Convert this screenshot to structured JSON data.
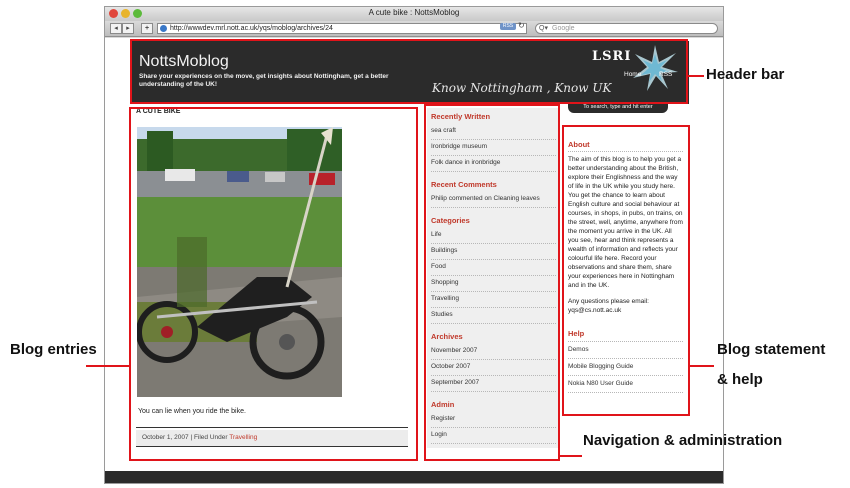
{
  "window": {
    "title": "A cute bike : NottsMoblog",
    "back_label": "◂",
    "forward_label": "▸",
    "add_label": "+",
    "url": "http://wwwdev.mrl.nott.ac.uk/yqs/moblog/archives/24",
    "rss_badge": "RSS",
    "reload_glyph": "↻",
    "search_placeholder": "Google"
  },
  "header": {
    "blog_title": "NottsMoblog",
    "tagline": "Share your experiences on the move, get insights about Nottingham, get a better understanding of the UK!",
    "slogan": "Know Nottingham , Know UK",
    "logo_text": "LSRI",
    "home_link": "Home",
    "rss_link": "RSS",
    "search_hint": "To search, type and hit enter"
  },
  "post": {
    "title": "A CUTE BIKE",
    "caption": "You can lie when you ride the bike.",
    "date": "October 1, 2007",
    "separator": "|",
    "filed_prefix": "Filed Under",
    "category": "Travelling"
  },
  "sidebar": {
    "recent_written": {
      "heading": "Recently Written",
      "items": [
        "sea craft",
        "Ironbridge museum",
        "Folk dance in ironbridge"
      ]
    },
    "recent_comments": {
      "heading": "Recent Comments",
      "items": [
        "Philip commented on Cleaning leaves"
      ]
    },
    "categories": {
      "heading": "Categories",
      "items": [
        "Life",
        "Buildings",
        "Food",
        "Shopping",
        "Travelling",
        "Studies"
      ]
    },
    "archives": {
      "heading": "Archives",
      "items": [
        "November 2007",
        "October 2007",
        "September 2007"
      ]
    },
    "admin": {
      "heading": "Admin",
      "items": [
        "Register",
        "Login"
      ]
    }
  },
  "about": {
    "heading": "About",
    "text": "The aim of this blog is to help you get a better understanding about the British, explore their Englishness and the way of life in the UK while you study here. You get the chance to learn about English culture and social behaviour at courses, in shops, in pubs, on trains, on the street, well, anytime, anywhere from the moment you arrive in the UK. All you see, hear and think represents a wealth of information and reflects your colourful life here. Record your observations and share them, share your experiences here in Nottingham and in the UK.",
    "contact": "Any questions please email: yqs@cs.nott.ac.uk",
    "help_heading": "Help",
    "help_items": [
      "Demos",
      "Mobile Blogging Guide",
      "Nokia N80 User Guide"
    ]
  },
  "annotations": {
    "header_bar": "Header bar",
    "blog_entries": "Blog entries",
    "blog_statement_line1": "Blog statement",
    "blog_statement_line2": "& help",
    "navigation": "Navigation & administration"
  },
  "colors": {
    "annotation_red": "#e0141a",
    "accent_red": "#c0392b",
    "header_dark": "#2b2b2b"
  }
}
